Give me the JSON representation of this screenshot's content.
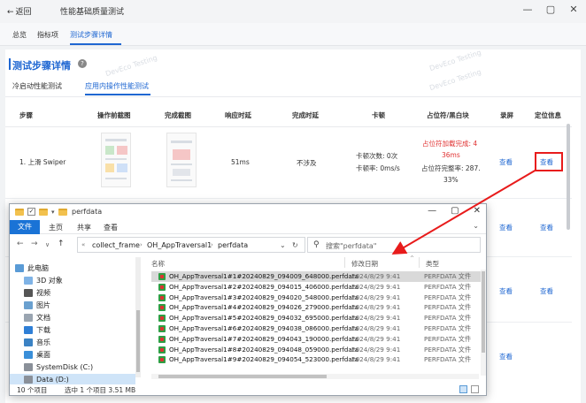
{
  "app": {
    "back_label": "返回",
    "title": "性能基础质量测试",
    "window_controls": [
      "—",
      "▢",
      "✕"
    ]
  },
  "tabs": [
    {
      "label": "总览"
    },
    {
      "label": "指标项"
    },
    {
      "label": "测试步骤详情",
      "active": true
    }
  ],
  "section": {
    "title": "测试步骤详情",
    "help_icon": "?",
    "watermark": "DevEco Testing"
  },
  "subtabs": [
    {
      "label": "冷启动性能测试"
    },
    {
      "label": "应用内操作性能测试",
      "active": true
    }
  ],
  "table": {
    "headers": [
      "步骤",
      "操作前截图",
      "完成截图",
      "响应时延",
      "完成时延",
      "卡顿",
      "占位符/黑白块",
      "录屏",
      "定位信息"
    ],
    "rows": [
      {
        "step": "1. 上滑 Swiper",
        "response": "51ms",
        "complete": "不涉及",
        "jank_count": "卡顿次数: 0次",
        "jank_rate": "卡顿率: 0ms/s",
        "placeholder_load_1": "占位符加载完成: 4",
        "placeholder_load_2": "36ms",
        "placeholder_rate_1": "占位符完整率: 287.",
        "placeholder_rate_2": "33%",
        "record": "查看",
        "locate": "查看"
      }
    ],
    "more_links": [
      "查看",
      "查看",
      "查看",
      "查看",
      "查看"
    ]
  },
  "explorer": {
    "title": "perfdata",
    "quick_access": [
      "✓",
      "▾"
    ],
    "window_controls": [
      "—",
      "▢",
      "✕"
    ],
    "ribbon": [
      "文件",
      "主页",
      "共享",
      "查看"
    ],
    "nav": [
      "←",
      "→",
      "∨",
      "↑"
    ],
    "address": [
      "collect_frame",
      "OH_AppTraversal1",
      "perfdata"
    ],
    "address_prefix": "«",
    "search_placeholder": "搜索\"perfdata\"",
    "nav_pane": [
      {
        "label": "此电脑",
        "icon": "computer-icon"
      },
      {
        "label": "3D 对象",
        "icon": "3d-objects-icon"
      },
      {
        "label": "视频",
        "icon": "video-icon"
      },
      {
        "label": "图片",
        "icon": "pictures-icon"
      },
      {
        "label": "文档",
        "icon": "documents-icon"
      },
      {
        "label": "下载",
        "icon": "downloads-icon"
      },
      {
        "label": "音乐",
        "icon": "music-icon"
      },
      {
        "label": "桌面",
        "icon": "desktop-icon"
      },
      {
        "label": "SystemDisk (C:)",
        "icon": "drive-icon"
      },
      {
        "label": "Data (D:)",
        "icon": "drive-icon"
      }
    ],
    "columns": [
      "名称",
      "修改日期",
      "类型"
    ],
    "files": [
      {
        "name": "OH_AppTraversal1#1#20240829_094009_648000.perfdata",
        "date": "2024/8/29 9:41",
        "type": "PERFDATA 文件"
      },
      {
        "name": "OH_AppTraversal1#2#20240829_094015_406000.perfdata",
        "date": "2024/8/29 9:41",
        "type": "PERFDATA 文件"
      },
      {
        "name": "OH_AppTraversal1#3#20240829_094020_548000.perfdata",
        "date": "2024/8/29 9:41",
        "type": "PERFDATA 文件"
      },
      {
        "name": "OH_AppTraversal1#4#20240829_094026_279000.perfdata",
        "date": "2024/8/29 9:41",
        "type": "PERFDATA 文件"
      },
      {
        "name": "OH_AppTraversal1#5#20240829_094032_695000.perfdata",
        "date": "2024/8/29 9:41",
        "type": "PERFDATA 文件"
      },
      {
        "name": "OH_AppTraversal1#6#20240829_094038_086000.perfdata",
        "date": "2024/8/29 9:41",
        "type": "PERFDATA 文件"
      },
      {
        "name": "OH_AppTraversal1#7#20240829_094043_190000.perfdata",
        "date": "2024/8/29 9:41",
        "type": "PERFDATA 文件"
      },
      {
        "name": "OH_AppTraversal1#8#20240829_094048_059000.perfdata",
        "date": "2024/8/29 9:41",
        "type": "PERFDATA 文件"
      },
      {
        "name": "OH_AppTraversal1#9#20240829_094054_523000.perfdata",
        "date": "2024/8/29 9:41",
        "type": "PERFDATA 文件"
      }
    ],
    "status": [
      "10 个项目",
      "选中 1 个项目 3.51 MB"
    ]
  },
  "colors": {
    "accent": "#1f67d2",
    "highlight": "#e81b1b",
    "placeholder_text": "#e03131"
  }
}
